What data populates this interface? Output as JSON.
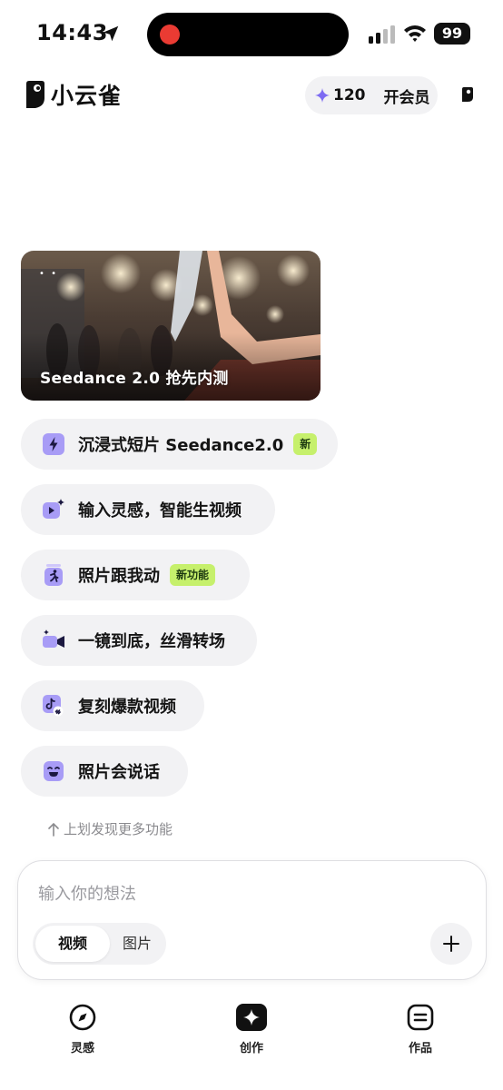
{
  "status_bar": {
    "time": "14:43",
    "battery": "99"
  },
  "header": {
    "app_name": "小云雀",
    "credits": "120",
    "member_label": "开会员"
  },
  "banner": {
    "caption": "Seedance 2.0 抢先内测"
  },
  "features": [
    {
      "label": "沉浸式短片 Seedance2.0",
      "badge": "新",
      "icon": "lightning-icon"
    },
    {
      "label": "输入灵感，智能生视频",
      "icon": "video-sparkle-icon"
    },
    {
      "label": "照片跟我动",
      "badge": "新功能",
      "icon": "dancing-person-icon"
    },
    {
      "label": "一镜到底，丝滑转场",
      "icon": "camera-sparkle-icon"
    },
    {
      "label": "复刻爆款视频",
      "icon": "tiktok-link-icon"
    },
    {
      "label": "照片会说话",
      "icon": "smiley-icon"
    }
  ],
  "swipe_hint": "上划发现更多功能",
  "composer": {
    "placeholder": "输入你的想法",
    "mode_video": "视频",
    "mode_image": "图片"
  },
  "bottom_nav": [
    {
      "label": "灵感",
      "icon": "compass-icon"
    },
    {
      "label": "创作",
      "icon": "sparkle-icon"
    },
    {
      "label": "作品",
      "icon": "list-icon"
    }
  ],
  "colors": {
    "accent_purple": "#7d6bf2",
    "badge_green": "#c6f06c",
    "pill_bg": "#f2f2f4"
  }
}
